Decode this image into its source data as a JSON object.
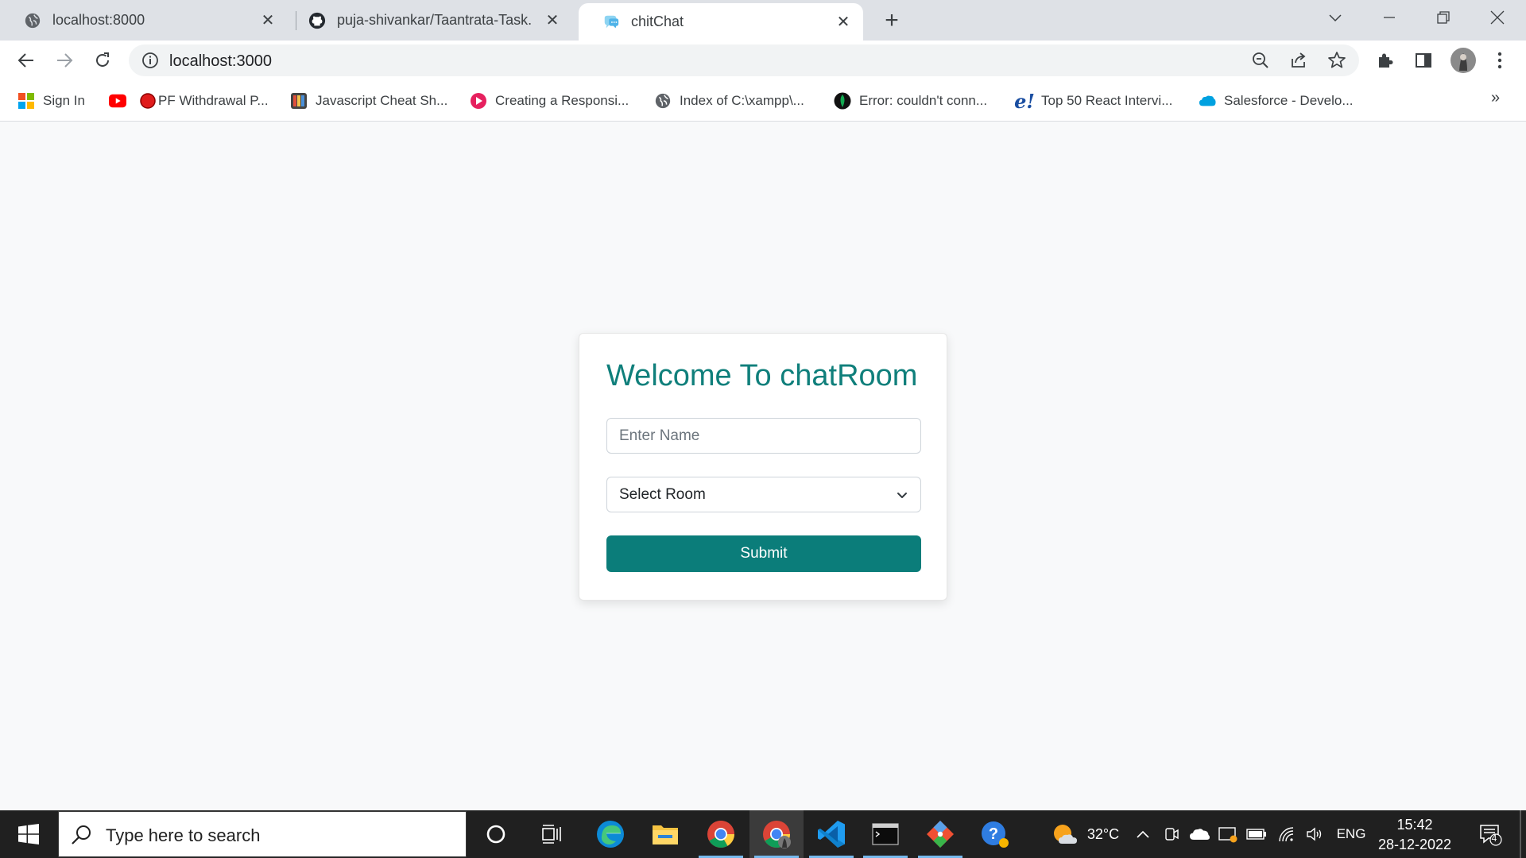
{
  "browser": {
    "tabs": [
      {
        "title": "localhost:8000",
        "icon": "globe-icon",
        "active": false
      },
      {
        "title": "puja-shivankar/Taantrata-Task.",
        "icon": "github-icon",
        "active": false
      },
      {
        "title": "chitChat",
        "icon": "chat-bubble-icon",
        "active": true
      }
    ],
    "address": "localhost:3000",
    "bookmarks": [
      {
        "label": "Sign In",
        "icon": "microsoft-icon"
      },
      {
        "label": "",
        "icon": "youtube-icon"
      },
      {
        "label": "PF Withdrawal P...",
        "icon": "red-circle-icon"
      },
      {
        "label": "Javascript Cheat Sh...",
        "icon": "cheat-sheet-icon"
      },
      {
        "label": "Creating a Responsi...",
        "icon": "pink-play-icon"
      },
      {
        "label": "Index of C:\\xampp\\...",
        "icon": "globe-icon"
      },
      {
        "label": "Error: couldn't conn...",
        "icon": "mongodb-leaf-icon"
      },
      {
        "label": "Top 50 React Intervi...",
        "icon": "edureka-icon"
      },
      {
        "label": "Salesforce - Develo...",
        "icon": "salesforce-cloud-icon"
      }
    ],
    "more_bookmarks": "»"
  },
  "page": {
    "heading": "Welcome To chatRoom",
    "name_placeholder": "Enter Name",
    "room_select_value": "Select Room",
    "submit_label": "Submit"
  },
  "taskbar": {
    "search_placeholder": "Type here to search",
    "weather": "32°C",
    "language": "ENG",
    "time": "15:42",
    "date": "28-12-2022",
    "notification_count": "4"
  },
  "colors": {
    "accent_teal": "#0b7d7a",
    "heading_teal": "#0f7f7b"
  }
}
